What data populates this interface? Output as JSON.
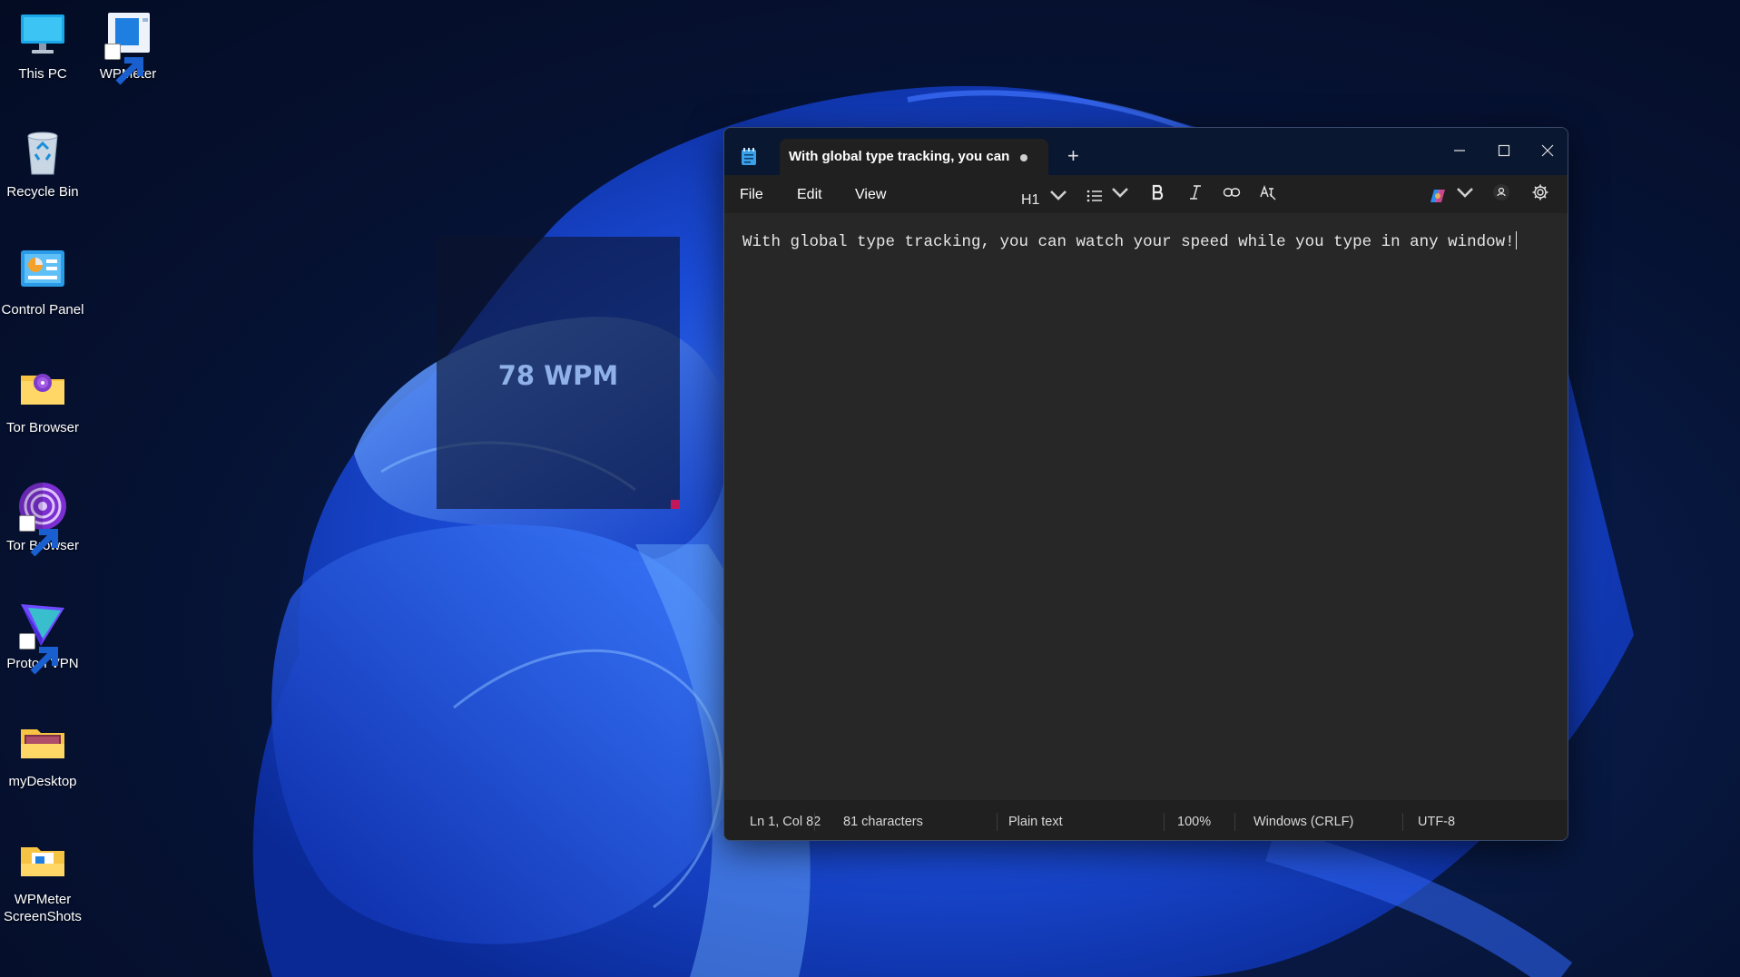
{
  "desktop": {
    "icons": [
      {
        "label": "This PC",
        "icon": "monitor-icon"
      },
      {
        "label": "WPMeter",
        "icon": "wpmeter-app-icon"
      },
      {
        "label": "Recycle Bin",
        "icon": "recycle-bin-icon"
      },
      {
        "label": "Control Panel",
        "icon": "control-panel-icon"
      },
      {
        "label": "Tor Browser",
        "icon": "folder-icon"
      },
      {
        "label": "Tor Browser",
        "icon": "tor-browser-icon"
      },
      {
        "label": "Proton VPN",
        "icon": "proton-vpn-icon"
      },
      {
        "label": "myDesktop",
        "icon": "folder-icon"
      },
      {
        "label": "WPMeter ScreenShots",
        "icon": "folder-icon"
      }
    ]
  },
  "wpm_overlay": {
    "value": "78 WPM",
    "resize_color": "#c2185b"
  },
  "notepad": {
    "tab_title": "With global type tracking, you can",
    "new_tab_label": "+",
    "menu": {
      "file": "File",
      "edit": "Edit",
      "view": "View"
    },
    "toolbar": {
      "heading": "H1",
      "list_icon": "bullet-list-icon",
      "bold_icon": "bold-icon",
      "italic_icon": "italic-icon",
      "link_icon": "link-icon",
      "clear_format_icon": "clear-formatting-icon",
      "copilot_icon": "copilot-icon",
      "account_icon": "account-icon",
      "settings_icon": "gear-icon"
    },
    "content": "With global type tracking, you can watch your speed while you type in any window!",
    "status": {
      "position": "Ln 1, Col 82",
      "characters": "81 characters",
      "format": "Plain text",
      "zoom": "100%",
      "line_ending": "Windows (CRLF)",
      "encoding": "UTF-8"
    }
  },
  "colors": {
    "accent": "#1f5fff",
    "titlebar": "#0a1730",
    "editor_bg": "#272727"
  }
}
